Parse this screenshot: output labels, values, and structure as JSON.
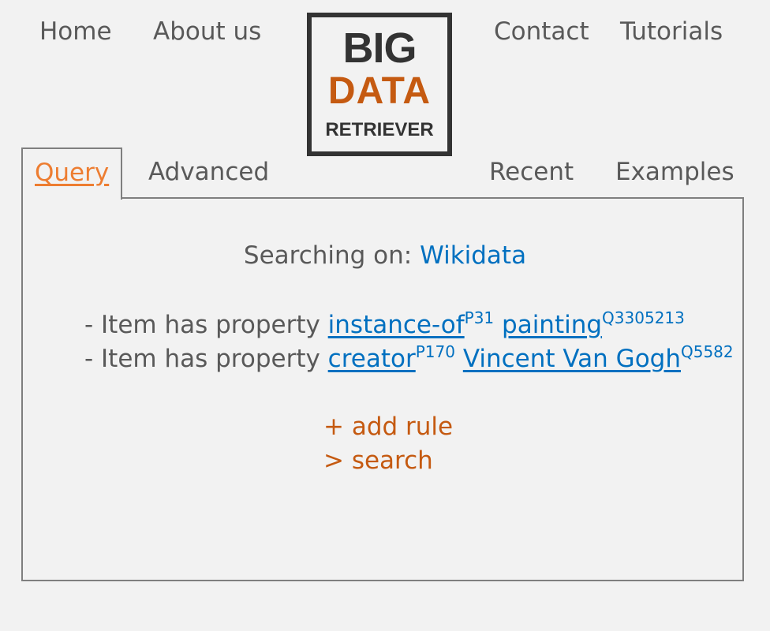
{
  "nav": {
    "home": "Home",
    "about": "About us",
    "contact": "Contact",
    "tutorials": "Tutorials"
  },
  "logo": {
    "line1": "BIG",
    "line2": "DATA",
    "line3": "RETRIEVER"
  },
  "tabs": {
    "query": "Query",
    "advanced": "Advanced",
    "recent": "Recent",
    "examples": "Examples"
  },
  "search": {
    "label": "Searching on: ",
    "source": "Wikidata"
  },
  "rules": [
    {
      "prefix": "- Item has property ",
      "property": "instance-of",
      "property_id": "P31",
      "value": "painting",
      "value_id": "Q3305213"
    },
    {
      "prefix": "- Item has property ",
      "property": "creator",
      "property_id": "P170",
      "value": "Vincent Van Gogh",
      "value_id": "Q5582"
    }
  ],
  "actions": {
    "add_rule": "+ add rule",
    "search": "> search"
  },
  "colors": {
    "background": "#f2f2f2",
    "text": "#595959",
    "link": "#0070c0",
    "accent": "#c55a11",
    "active_tab": "#ed7d31",
    "border": "#7f7f7f"
  }
}
